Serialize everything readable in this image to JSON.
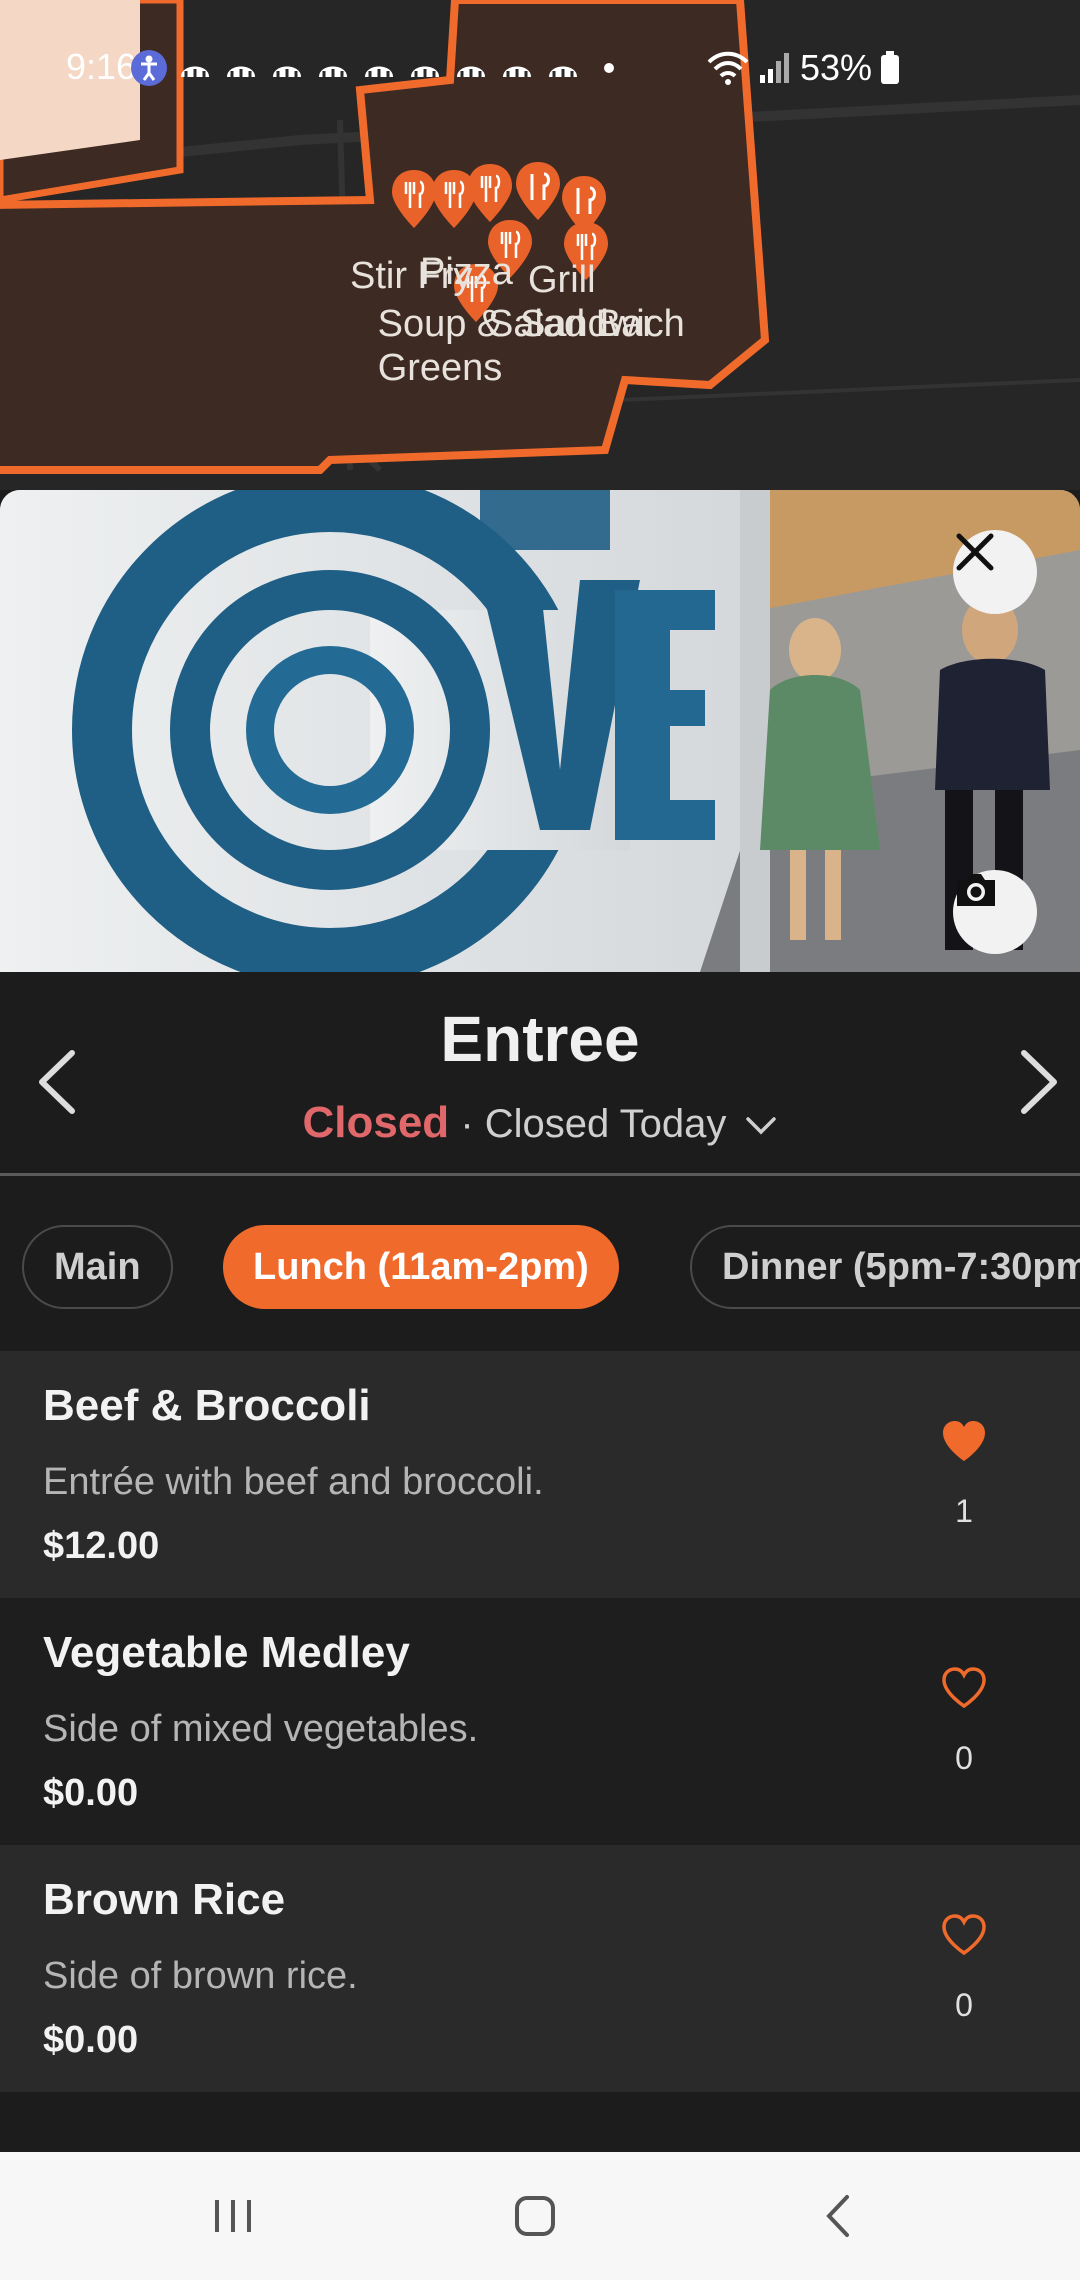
{
  "status_bar": {
    "time": "9:16",
    "battery": "53%"
  },
  "map": {
    "labels": {
      "stir_fry": "Stir Fry",
      "pizza": "Pizza",
      "grill": "Grill",
      "salad_bar": "Salad Bar",
      "sandwich": "Sandwich",
      "soup_greens": "Soup & Greens"
    }
  },
  "header": {
    "title": "Entree",
    "status": "Closed",
    "hours": "Closed Today"
  },
  "tabs": [
    {
      "label": "Main",
      "active": false
    },
    {
      "label": "Lunch (11am-2pm)",
      "active": true
    },
    {
      "label": "Dinner (5pm-7:30pm)",
      "active": false
    }
  ],
  "menu_items": [
    {
      "name": "Beef & Broccoli",
      "description": "Entrée with beef and broccoli.",
      "price": "$12.00",
      "likes": "1",
      "liked": true
    },
    {
      "name": "Vegetable Medley",
      "description": "Side of mixed vegetables.",
      "price": "$0.00",
      "likes": "0",
      "liked": false
    },
    {
      "name": "Brown Rice",
      "description": "Side of brown rice.",
      "price": "$0.00",
      "likes": "0",
      "liked": false
    }
  ],
  "colors": {
    "accent": "#f06a2c",
    "closed": "#e0676a",
    "map_building": "#3d2a22",
    "map_outline": "#f06a2c"
  },
  "icons": {
    "prev": "chevron-left-icon",
    "next": "chevron-right-icon",
    "close": "close-icon",
    "camera": "camera-icon",
    "heart_filled": "heart-filled-icon",
    "heart_outline": "heart-outline-icon",
    "pin": "restaurant-pin-icon"
  }
}
